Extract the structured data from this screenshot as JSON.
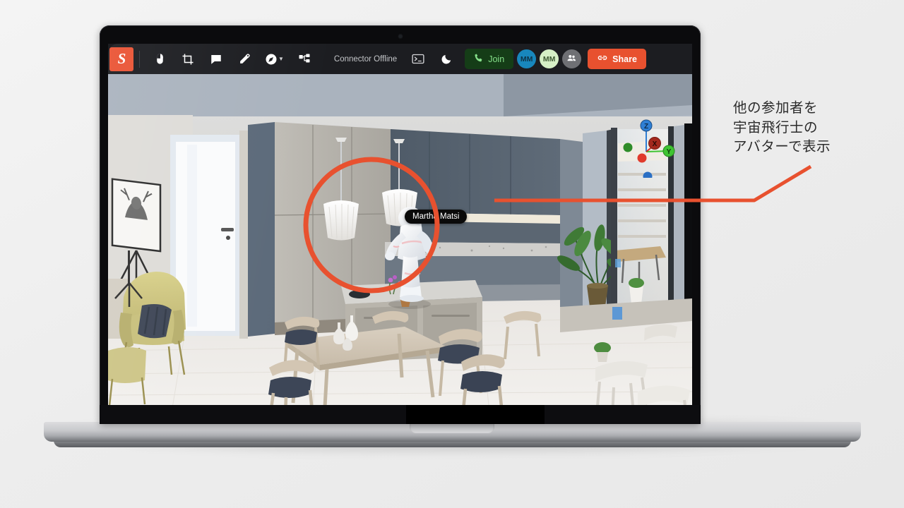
{
  "app": {
    "logo_letter": "S",
    "status_text": "Connector Offline",
    "toolbar_items": [
      {
        "name": "logo",
        "label": "S"
      },
      {
        "name": "select-tool",
        "label": "Select"
      },
      {
        "name": "crop-tool",
        "label": "Crop"
      },
      {
        "name": "comment-tool",
        "label": "Comment"
      },
      {
        "name": "eyedropper-tool",
        "label": "Eyedropper"
      },
      {
        "name": "navigate-tool",
        "label": "Navigate"
      },
      {
        "name": "hierarchy-tool",
        "label": "Hierarchy"
      }
    ],
    "console_label": "Console",
    "theme_toggle_label": "Dark mode",
    "join_label": "Join",
    "share_label": "Share",
    "avatars": [
      {
        "initials": "MM",
        "color": "#1887bd"
      },
      {
        "initials": "MM",
        "color": "#d6f0c6"
      }
    ],
    "participants_icon_label": "Participants"
  },
  "viewport": {
    "nametag": "Martha Matsi",
    "gizmo": {
      "x_label": "X",
      "y_label": "Y",
      "z_label": "Z",
      "x_color": "#d92b20",
      "y_color": "#3fc432",
      "z_color": "#2f7fd4"
    }
  },
  "annotation": {
    "line1": "他の参加者を",
    "line2": "宇宙飛行士の",
    "line3": "アバターで表示",
    "accent_color": "#e8512f"
  }
}
